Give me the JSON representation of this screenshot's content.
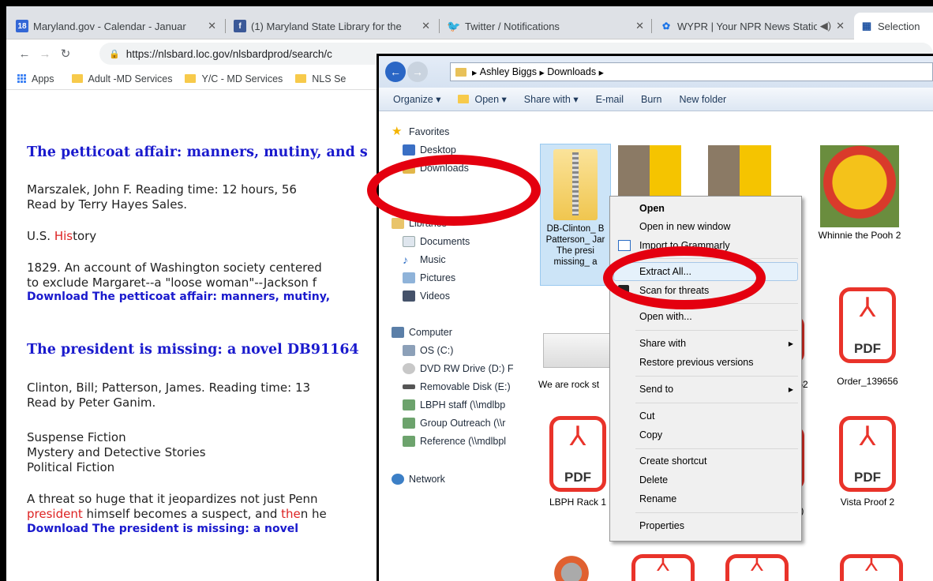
{
  "browser": {
    "tabs": [
      {
        "label": "Maryland.gov - Calendar - Januar",
        "icon": "calendar-icon",
        "fav_text": "18"
      },
      {
        "label": "(1) Maryland State Library for the",
        "icon": "facebook-icon",
        "fav_text": "f"
      },
      {
        "label": "Twitter / Notifications",
        "icon": "twitter-icon",
        "fav_text": ""
      },
      {
        "label": "WYPR | Your NPR News Statio",
        "icon": "wypr-icon",
        "fav_text": ""
      },
      {
        "label": "Selection",
        "icon": "nls-icon",
        "fav_text": ""
      }
    ],
    "url": "https://nlsbard.loc.gov/nlsbardprod/search/c",
    "bookmarks": [
      "Apps",
      "Adult -MD Services",
      "Y/C - MD Services",
      "NLS Se"
    ]
  },
  "page": {
    "book1": {
      "title": "The petticoat affair: manners, mutiny, and s",
      "author_line": "Marszalek, John F. Reading time: 12 hours, 56",
      "reader": "Read by Terry Hayes Sales.",
      "subject_a": "U.S. ",
      "subject_b": "His",
      "subject_c": "tory",
      "desc1": "1829. An account of Washington society centered",
      "desc2": "to exclude Margaret--a \"loose woman\"--Jackson f",
      "download": "Download The petticoat affair: manners, mutiny,"
    },
    "book2": {
      "title": "The president is missing: a novel DB91164",
      "author_line": "Clinton, Bill; Patterson, James. Reading time: 13",
      "reader": "Read by Peter Ganim.",
      "subjects": [
        "Suspense Fiction",
        "Mystery and Detective Stories",
        "Political Fiction"
      ],
      "desc1": "A threat so huge that it jeopardizes not just Penn",
      "desc2_a": "president",
      "desc2_b": " himself becomes a suspect, and ",
      "desc2_c": "the",
      "desc2_d": "n he",
      "download": "Download The president is missing: a novel"
    }
  },
  "explorer": {
    "breadcrumb": [
      "Ashley Biggs",
      "Downloads"
    ],
    "toolbar": [
      "Organize ▾",
      "Open ▾",
      "Share with ▾",
      "E-mail",
      "Burn",
      "New folder"
    ],
    "nav": {
      "favorites": "Favorites",
      "desktop": "Desktop",
      "downloads": "Downloads",
      "libraries": "Libraries",
      "documents": "Documents",
      "music": "Music",
      "pictures": "Pictures",
      "videos": "Videos",
      "computer": "Computer",
      "os": "OS (C:)",
      "dvd": "DVD RW Drive (D:) F",
      "removable": "Removable Disk (E:)",
      "lbph": "LBPH staff (\\\\mdlbp",
      "group": "Group Outreach (\\\\r",
      "reference": "Reference (\\\\mdlbpl",
      "network": "Network"
    },
    "files": {
      "zip_name": "DB-Clinton_ B Patterson_ Jar The presi missing_ a",
      "pooh_e": "e",
      "whinnie": "Whinnie the Pooh 2",
      "rockstars": "We are rock st",
      "n62": "62",
      "order": "Order_139656",
      "rack": "LBPH Rack 1",
      "n5": "(5)",
      "vista": "Vista Proof 2",
      "pdf": "PDF"
    }
  },
  "context_menu": {
    "items": [
      "Open",
      "Open in new window",
      "Import to Grammarly",
      "Extract All...",
      "Scan for threats",
      "Open with...",
      "Share with",
      "Restore previous versions",
      "Send to",
      "Cut",
      "Copy",
      "Create shortcut",
      "Delete",
      "Rename",
      "Properties"
    ]
  },
  "colors": {
    "annotation_red": "#e4000f",
    "link_blue": "#1a1acd",
    "pdf_red": "#e9332a"
  }
}
